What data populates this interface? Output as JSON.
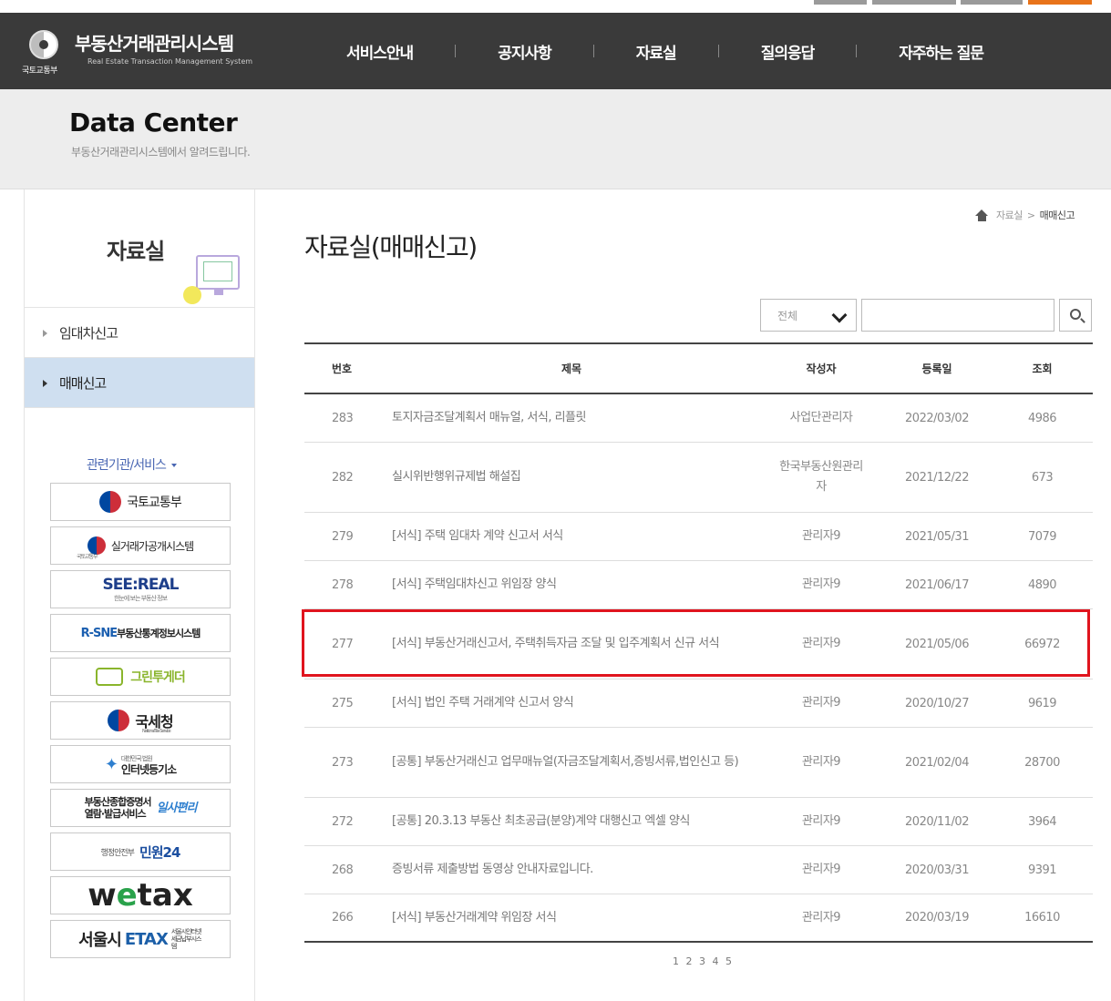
{
  "header": {
    "logo_title": "부동산거래관리시스템",
    "logo_sub": "Real Estate Transaction Management System",
    "ministry": "국토교통부",
    "nav": [
      "서비스안내",
      "공지사항",
      "자료실",
      "질의응답",
      "자주하는 질문"
    ]
  },
  "subvisual": {
    "title": "Data Center",
    "desc": "부동산거래관리시스템에서 알려드립니다."
  },
  "sidebar": {
    "title": "자료실",
    "items": [
      {
        "label": "임대차신고",
        "active": false
      },
      {
        "label": "매매신고",
        "active": true
      }
    ],
    "related_title": "관련기관/서비스",
    "banners": {
      "molit": "국토교통부",
      "rtms": "실거래가공개시스템",
      "rtms_tag": "국토교통부",
      "seereal": "SEE:REAL",
      "seereal_sub": "한눈에 보는 부동산 정보",
      "rsne_prefix": "R-SNE",
      "rsne_text": "부동산통계정보시스템",
      "green": "그린투게더",
      "nts": "국세청",
      "nts_sub": "National Tax Service",
      "iros": "인터넷등기소",
      "iros_tag": "대한민국 법원",
      "ilsa_line1": "부동산종합증명서",
      "ilsa_line2": "열람·발급서비스",
      "ilsa_brand": "일사편리",
      "minwon_tag": "행정안전부",
      "minwon": "민원24",
      "wetax_a": "w",
      "wetax_b": "e",
      "wetax_c": "tax",
      "etax_city": "서울시",
      "etax_brand": "ETAX",
      "etax_tag": "서울시인터넷세금납부시스템"
    }
  },
  "breadcrumb": {
    "parent": "자료실",
    "sep": ">",
    "current": "매매신고"
  },
  "page_title": "자료실(매매신고)",
  "search": {
    "select_value": "전체",
    "input_value": ""
  },
  "board": {
    "headers": {
      "no": "번호",
      "title": "제목",
      "writer": "작성자",
      "date": "등록일",
      "views": "조회"
    },
    "rows": [
      {
        "no": "283",
        "title": "토지자금조달계획서 매뉴얼, 서식, 리플릿",
        "writer": "사업단관리자",
        "date": "2022/03/02",
        "views": "4986"
      },
      {
        "no": "282",
        "title": "실시위반행위규제법 해설집",
        "writer": "한국부동산원관리자",
        "date": "2021/12/22",
        "views": "673"
      },
      {
        "no": "279",
        "title": "[서식] 주택 임대차 계약 신고서 서식",
        "writer": "관리자9",
        "date": "2021/05/31",
        "views": "7079"
      },
      {
        "no": "278",
        "title": "[서식] 주택임대차신고 위임장 양식",
        "writer": "관리자9",
        "date": "2021/06/17",
        "views": "4890"
      },
      {
        "no": "277",
        "title": "[서식] 부동산거래신고서, 주택취득자금 조달 및 입주계획서 신규 서식",
        "writer": "관리자9",
        "date": "2021/05/06",
        "views": "66972"
      },
      {
        "no": "275",
        "title": "[서식] 법인 주택 거래계약 신고서 양식",
        "writer": "관리자9",
        "date": "2020/10/27",
        "views": "9619"
      },
      {
        "no": "273",
        "title": "[공통] 부동산거래신고 업무매뉴얼(자금조달계획서,증빙서류,법인신고 등)",
        "writer": "관리자9",
        "date": "2021/02/04",
        "views": "28700"
      },
      {
        "no": "272",
        "title": "[공통] 20.3.13 부동산 최초공급(분양)계약 대행신고 엑셀 양식",
        "writer": "관리자9",
        "date": "2020/11/02",
        "views": "3964"
      },
      {
        "no": "268",
        "title": "증빙서류 제출방법 동영상 안내자료입니다.",
        "writer": "관리자9",
        "date": "2020/03/31",
        "views": "9391"
      },
      {
        "no": "266",
        "title": "[서식] 부동산거래계약 위임장 서식",
        "writer": "관리자9",
        "date": "2020/03/19",
        "views": "16610"
      }
    ]
  },
  "paging": [
    "1",
    "2",
    "3",
    "4",
    "5"
  ],
  "colors": {
    "header_bg": "#3a3a3a",
    "active_menu": "#cfdff0",
    "highlight": "#e0141e",
    "related_blue": "#4a67b3"
  }
}
